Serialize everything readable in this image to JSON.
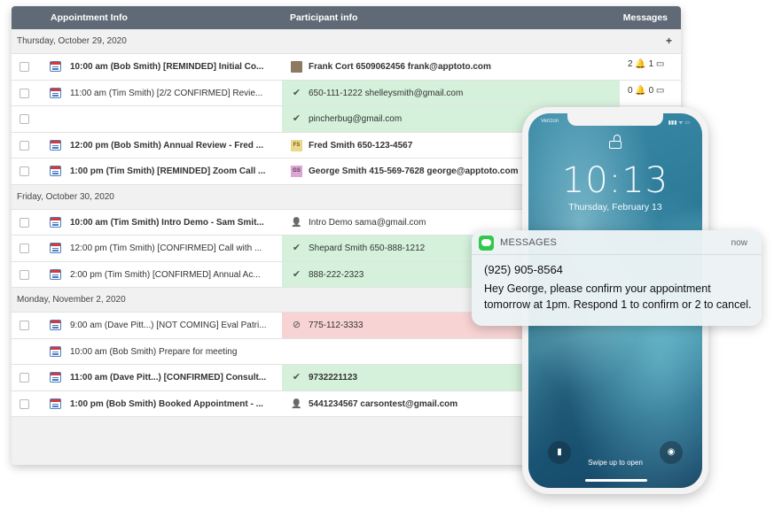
{
  "table": {
    "headers": {
      "appointment": "Appointment Info",
      "participant": "Participant info",
      "messages": "Messages"
    },
    "add_symbol": "+",
    "rows": [
      {
        "kind": "date",
        "label": "Thursday, October 29, 2020"
      },
      {
        "kind": "appt",
        "checkbox": true,
        "calendar": true,
        "bold": true,
        "text": "10:00 am   (Bob Smith)   [REMINDED] Initial Co...",
        "participant_icon": "photo",
        "participant_style": "",
        "participant_bold": true,
        "participant": "Frank Cort   6509062456   frank@apptoto.com",
        "messages": "2 🔔 1 ▭"
      },
      {
        "kind": "appt",
        "checkbox": true,
        "calendar": true,
        "bold": false,
        "text": "11:00 am   (Tim Smith)   [2/2 CONFIRMED] Revie...",
        "participant_icon": "check",
        "participant_style": "green",
        "participant_bold": false,
        "participant": "650-111-1222   shelleysmith@gmail.com",
        "messages": "0 🔔 0 ▭"
      },
      {
        "kind": "appt",
        "checkbox": true,
        "calendar": false,
        "bold": false,
        "text": "",
        "participant_icon": "check",
        "participant_style": "green",
        "participant_bold": false,
        "participant": "pincherbug@gmail.com",
        "messages": ""
      },
      {
        "kind": "appt",
        "checkbox": true,
        "calendar": true,
        "bold": true,
        "text": "12:00 pm   (Bob Smith)   Annual Review - Fred ...",
        "participant_icon": "FS",
        "participant_style": "",
        "participant_bold": true,
        "participant": "Fred Smith   650-123-4567",
        "messages": ""
      },
      {
        "kind": "appt",
        "checkbox": true,
        "calendar": true,
        "bold": true,
        "text": "1:00 pm   (Tim Smith)   [REMINDED] Zoom Call ...",
        "participant_icon": "GS",
        "participant_style": "",
        "participant_bold": true,
        "participant": "George Smith   415-569-7628   george@apptoto.com",
        "messages": ""
      },
      {
        "kind": "date",
        "label": "Friday, October 30, 2020"
      },
      {
        "kind": "appt",
        "checkbox": true,
        "calendar": true,
        "bold": true,
        "text": "10:00 am   (Tim Smith)   Intro Demo - Sam Smit...",
        "participant_icon": "person",
        "participant_style": "",
        "participant_bold": false,
        "participant": "Intro Demo   sama@gmail.com",
        "messages": ""
      },
      {
        "kind": "appt",
        "checkbox": true,
        "calendar": true,
        "bold": false,
        "text": "12:00 pm   (Tim Smith)   [CONFIRMED] Call with ...",
        "participant_icon": "check",
        "participant_style": "green",
        "participant_bold": false,
        "participant": "Shepard Smith   650-888-1212",
        "messages": ""
      },
      {
        "kind": "appt",
        "checkbox": true,
        "calendar": true,
        "bold": false,
        "text": "2:00 pm   (Tim Smith)   [CONFIRMED] Annual Ac...",
        "participant_icon": "check",
        "participant_style": "green",
        "participant_bold": false,
        "participant": "888-222-2323",
        "messages": ""
      },
      {
        "kind": "date",
        "label": "Monday, November 2, 2020"
      },
      {
        "kind": "appt",
        "checkbox": true,
        "calendar": true,
        "bold": false,
        "text": "9:00 am   (Dave Pitt...)   [NOT COMING] Eval Patri...",
        "participant_icon": "ban",
        "participant_style": "red",
        "participant_bold": false,
        "participant": "775-112-3333",
        "messages": ""
      },
      {
        "kind": "appt",
        "checkbox": false,
        "calendar": true,
        "bold": false,
        "text": "10:00 am   (Bob Smith)   Prepare for meeting",
        "participant_icon": "",
        "participant_style": "",
        "participant_bold": false,
        "participant": "",
        "messages": ""
      },
      {
        "kind": "appt",
        "checkbox": true,
        "calendar": true,
        "bold": true,
        "text": "11:00 am   (Dave Pitt...)   [CONFIRMED] Consult...",
        "participant_icon": "check",
        "participant_style": "green",
        "participant_bold": true,
        "participant": "9732221123",
        "messages": ""
      },
      {
        "kind": "appt",
        "checkbox": true,
        "calendar": true,
        "bold": true,
        "text": "1:00 pm   (Bob Smith)   Booked Appointment - ...",
        "participant_icon": "person",
        "participant_style": "",
        "participant_bold": true,
        "participant": "5441234567   carsontest@gmail.com",
        "messages": ""
      }
    ]
  },
  "phone": {
    "carrier": "Verizon",
    "status_icons": "▮▮▮ ᯤ ▭",
    "time": "10:13",
    "date": "Thursday, February 13",
    "swipe_text": "Swipe up to open",
    "flashlight_icon": "flashlight-icon",
    "camera_icon": "camera-icon"
  },
  "notification": {
    "app": "MESSAGES",
    "time": "now",
    "title": "(925) 905-8564",
    "body": "Hey George, please confirm your appointment tomorrow at 1pm. Respond 1 to confirm or 2 to cancel."
  },
  "colors": {
    "header_bg": "#606a76",
    "confirmed_bg": "#d5f1dc",
    "not_coming_bg": "#f8d3d3",
    "messages_app": "#34c84a"
  }
}
